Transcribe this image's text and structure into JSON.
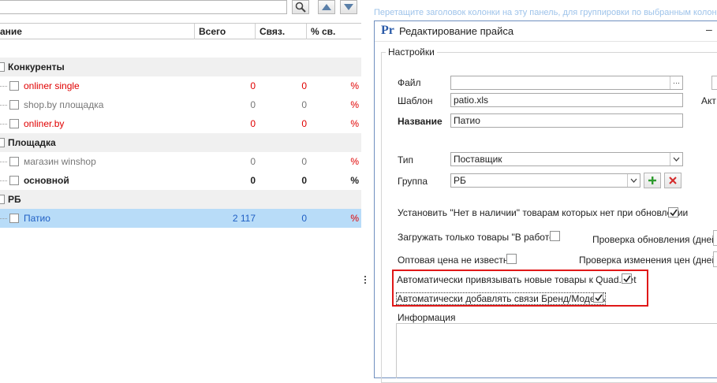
{
  "grid": {
    "columns": [
      {
        "key": "name",
        "label": "ание"
      },
      {
        "key": "total",
        "label": "Всего"
      },
      {
        "key": "links",
        "label": "Связ."
      },
      {
        "key": "pct",
        "label": "% св."
      }
    ],
    "rows": [
      {
        "type": "group",
        "label": "Конкуренты"
      },
      {
        "type": "item",
        "label": "onliner single",
        "total": "0",
        "links": "0",
        "pct": "%",
        "color": "red"
      },
      {
        "type": "item",
        "label": "shop.by площадка",
        "total": "0",
        "links": "0",
        "pct": "%",
        "color": "grey"
      },
      {
        "type": "item",
        "label": "onliner.by",
        "total": "0",
        "links": "0",
        "pct": "%",
        "color": "red"
      },
      {
        "type": "group",
        "label": "Площадка"
      },
      {
        "type": "item",
        "label": "магазин winshop",
        "total": "0",
        "links": "0",
        "pct": "%",
        "color": "grey"
      },
      {
        "type": "item",
        "label": "основной",
        "total": "0",
        "links": "0",
        "pct": "%",
        "color": "bold"
      },
      {
        "type": "group",
        "label": "РБ"
      },
      {
        "type": "item",
        "label": "Патио",
        "total": "2 117",
        "links": "0",
        "pct": "%",
        "color": "blue",
        "selected": true
      }
    ]
  },
  "background_hint": "Перетащите заголовок колонки на эту панель, для группировки по выбранным колонкам",
  "dialog": {
    "logo": "Pr",
    "title": "Редактирование прайса",
    "min_label": "–",
    "section": "Настройки",
    "file_label": "Файл",
    "file_value": "",
    "file_browse": "···",
    "template_label": "Шаблон",
    "template_value": "patio.xls",
    "name_label": "Название",
    "name_value": "Патио",
    "active_label": "Акт",
    "type_label": "Тип",
    "type_value": "Поставщик",
    "group_label": "Группа",
    "group_value": "РБ",
    "opt_not_in_stock": "Установить \"Нет в наличии\" товарам которых нет при обновлении",
    "opt_only_in_work": "Загружать только товары \"В работе\"",
    "check_update_label": "Проверка обновления (дней)",
    "opt_wholesale_unknown": "Оптовая цена не известна",
    "check_price_label": "Проверка изменения цен (дней)",
    "opt_auto_bind_quad": "Автоматически привязывать новые товары к Quad.Net",
    "opt_auto_add_brand": "Автоматически добавлять связи Бренд/Модель",
    "info_label": "Информация"
  },
  "colors": {
    "red": "#e00000",
    "grey": "#777777",
    "blue": "#1f5fc4",
    "selection": "#b8dcf8",
    "highlight": "#e01818",
    "add_green": "#2e9b2e",
    "delete_red": "#d42a2a"
  }
}
